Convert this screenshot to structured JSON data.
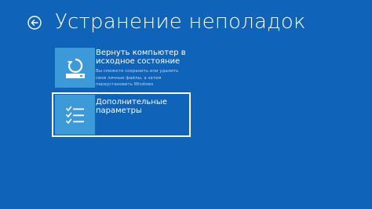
{
  "header": {
    "back_icon": "back-arrow-icon",
    "title": "Устранение неполадок"
  },
  "options": [
    {
      "icon": "reset-pc-icon",
      "title": "Вернуть компьютер в исходное состояние",
      "description": "Вы сможете сохранить или удалить свои личные файлы, а затем переустановить Windows"
    },
    {
      "icon": "checklist-icon",
      "title": "Дополнительные параметры",
      "selected": true
    }
  ],
  "colors": {
    "background": "#0f63b8",
    "tile": "#3c9ad9",
    "text": "#ffffff"
  }
}
